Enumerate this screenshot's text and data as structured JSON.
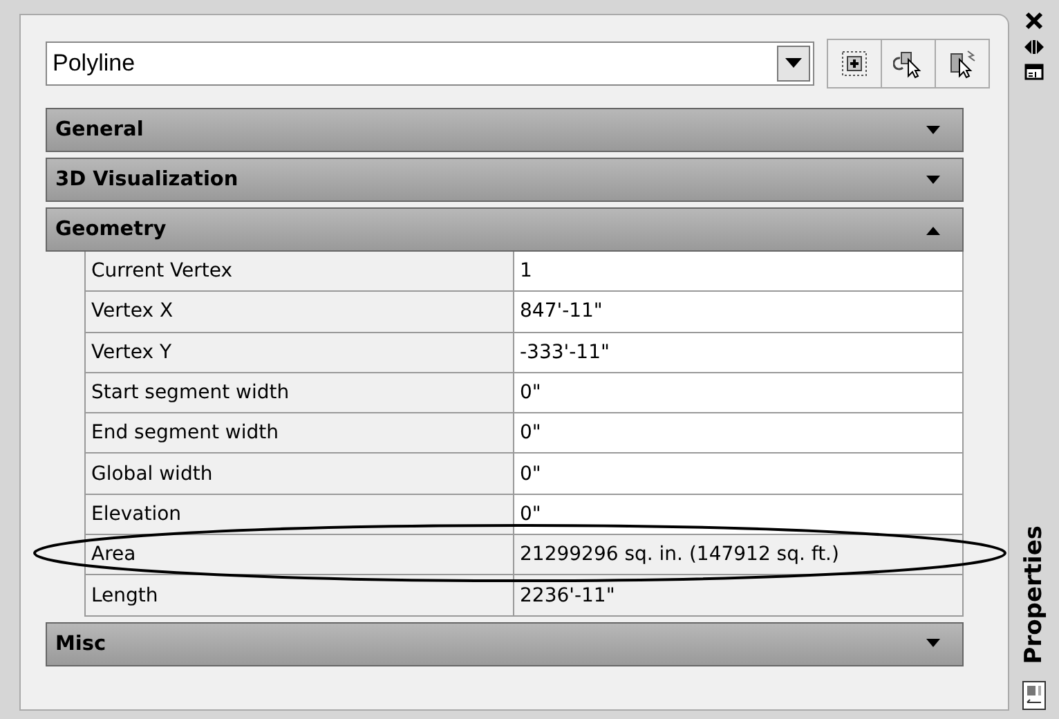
{
  "object_type": {
    "value": "Polyline"
  },
  "sections": [
    {
      "title": "General",
      "expanded": false
    },
    {
      "title": "3D Visualization",
      "expanded": false
    },
    {
      "title": "Geometry",
      "expanded": true,
      "rows": [
        {
          "label": "Current Vertex",
          "value": "1",
          "readonly": false
        },
        {
          "label": "Vertex X",
          "value": "847'-11\"",
          "readonly": false
        },
        {
          "label": "Vertex Y",
          "value": "-333'-11\"",
          "readonly": false
        },
        {
          "label": "Start segment width",
          "value": "0\"",
          "readonly": false
        },
        {
          "label": "End segment width",
          "value": "0\"",
          "readonly": false
        },
        {
          "label": "Global width",
          "value": "0\"",
          "readonly": false
        },
        {
          "label": "Elevation",
          "value": "0\"",
          "readonly": false
        },
        {
          "label": "Area",
          "value": "21299296 sq. in. (147912 sq. ft.)",
          "readonly": true
        },
        {
          "label": "Length",
          "value": "2236'-11\"",
          "readonly": true
        }
      ]
    },
    {
      "title": "Misc",
      "expanded": false
    }
  ],
  "side_strip": {
    "title": "Properties"
  }
}
